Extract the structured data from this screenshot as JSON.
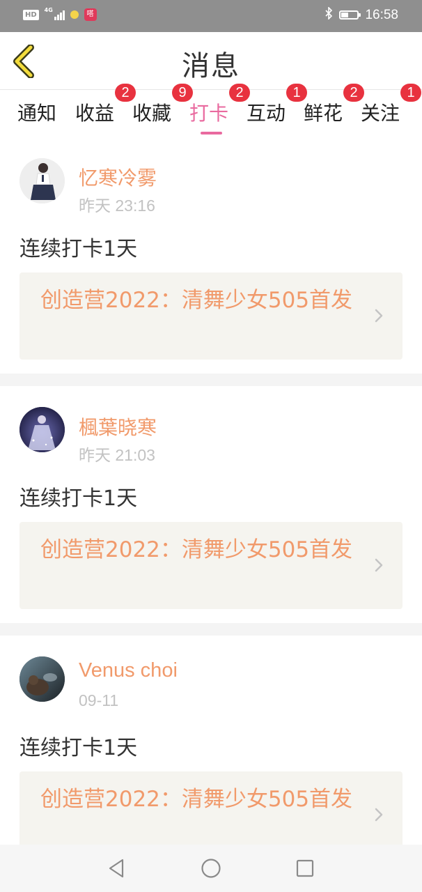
{
  "status_bar": {
    "hd_label": "HD",
    "network_label": "4G",
    "app_badge_label": "嗒",
    "time": "16:58",
    "battery_level": 0.45
  },
  "header": {
    "title": "消息",
    "back_icon": "chevron-left-icon"
  },
  "tabs": [
    {
      "label": "通知",
      "badge": ""
    },
    {
      "label": "收益",
      "badge": "2"
    },
    {
      "label": "收藏",
      "badge": "9"
    },
    {
      "label": "打卡",
      "badge": "2",
      "active": true
    },
    {
      "label": "互动",
      "badge": "1"
    },
    {
      "label": "鲜花",
      "badge": "2"
    },
    {
      "label": "关注",
      "badge": "1"
    }
  ],
  "feed": [
    {
      "username": "忆寒冷雾",
      "time": "昨天 23:16",
      "checkin": "连续打卡1天",
      "link_text": "创造营2022：清舞少女505首发"
    },
    {
      "username": "楓葉晓寒",
      "time": "昨天 21:03",
      "checkin": "连续打卡1天",
      "link_text": "创造营2022：清舞少女505首发"
    },
    {
      "username": "Venus choi",
      "time": "09-11",
      "checkin": "连续打卡1天",
      "link_text": "创造营2022：清舞少女505首发"
    }
  ],
  "nav_bar": {
    "back": "triangle-back-icon",
    "home": "circle-home-icon",
    "recent": "square-recent-icon"
  },
  "colors": {
    "accent_pink": "#e96a9f",
    "name_orange": "#f19a6b",
    "badge_red": "#e8323f"
  }
}
